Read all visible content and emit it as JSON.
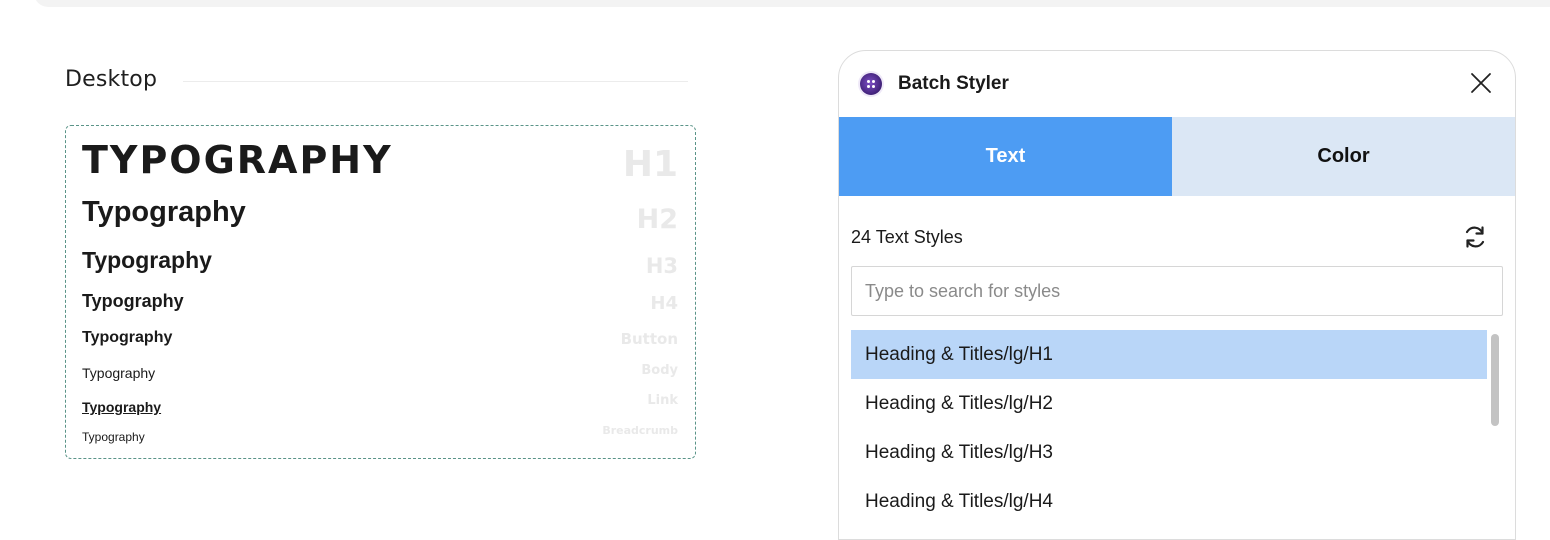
{
  "desktop": {
    "title": "Desktop",
    "samples": [
      {
        "text": "TYPOGRAPHY",
        "tag": "H1"
      },
      {
        "text": "Typography",
        "tag": "H2"
      },
      {
        "text": "Typography",
        "tag": "H3"
      },
      {
        "text": "Typography",
        "tag": "H4"
      },
      {
        "text": "Typography",
        "tag": "Button"
      },
      {
        "text": "Typography",
        "tag": "Body"
      },
      {
        "text": "Typography",
        "tag": "Link"
      },
      {
        "text": "Typography",
        "tag": "Breadcrumb"
      }
    ]
  },
  "panel": {
    "title": "Batch Styler",
    "logo_icon": "batch-styler-logo",
    "close_icon": "close-icon",
    "tabs": [
      {
        "label": "Text",
        "active": true
      },
      {
        "label": "Color",
        "active": false
      }
    ],
    "count_label": "24 Text Styles",
    "refresh_icon": "refresh-icon",
    "search": {
      "placeholder": "Type to search for styles",
      "value": ""
    },
    "styles": [
      {
        "label": "Heading & Titles/lg/H1",
        "selected": true
      },
      {
        "label": "Heading & Titles/lg/H2",
        "selected": false
      },
      {
        "label": "Heading & Titles/lg/H3",
        "selected": false
      },
      {
        "label": "Heading & Titles/lg/H4",
        "selected": false
      }
    ],
    "colors": {
      "active_tab": "#4d9cf3",
      "inactive_tab": "#dbe7f5",
      "selected_row": "#b9d6f8",
      "frame_border": "#5a9488"
    }
  }
}
